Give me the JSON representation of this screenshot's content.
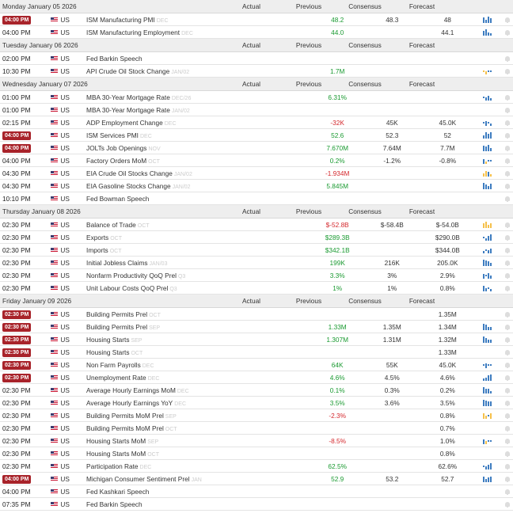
{
  "columns": {
    "actual": "Actual",
    "previous": "Previous",
    "consensus": "Consensus",
    "forecast": "Forecast"
  },
  "colors": {
    "badge": "#a8232a",
    "positive": "#1a9a31",
    "negative": "#d4282d",
    "chart_bar": "#3d7cc0",
    "chart_alt": "#f5c04a"
  },
  "days": [
    {
      "title": "Monday January 05 2026",
      "events": [
        {
          "time": "04:00 PM",
          "badge": true,
          "currency": "US",
          "name": "ISM Manufacturing PMI",
          "period": "DEC",
          "actual": "",
          "previous": "48.2",
          "prev_color": "green",
          "consensus": "48.3",
          "forecast": "48",
          "chart": "b5,b3,b6,b4"
        },
        {
          "time": "04:00 PM",
          "badge": false,
          "currency": "US",
          "name": "ISM Manufacturing Employment",
          "period": "DEC",
          "actual": "",
          "previous": "44.0",
          "prev_color": "green",
          "consensus": "",
          "forecast": "44.1",
          "chart": "b4,b6,b3,b2"
        }
      ]
    },
    {
      "title": "Tuesday January 06 2026",
      "events": [
        {
          "time": "02:00 PM",
          "badge": false,
          "currency": "US",
          "name": "Fed Barkin Speech",
          "period": "",
          "actual": "",
          "previous": "",
          "prev_color": "",
          "consensus": "",
          "forecast": "",
          "chart": ""
        },
        {
          "time": "10:30 PM",
          "badge": false,
          "currency": "US",
          "name": "API Crude Oil Stock Change",
          "period": "JAN/02",
          "actual": "",
          "previous": "1.7M",
          "prev_color": "green",
          "consensus": "",
          "forecast": "",
          "chart": "dy,y3,d,d"
        }
      ]
    },
    {
      "title": "Wednesday January 07 2026",
      "events": [
        {
          "time": "01:00 PM",
          "badge": false,
          "currency": "US",
          "name": "MBA 30-Year Mortgage Rate",
          "period": "DEC/26",
          "actual": "",
          "previous": "6.31%",
          "prev_color": "green",
          "consensus": "",
          "forecast": "",
          "chart": "d,b3,b4,b2"
        },
        {
          "time": "01:00 PM",
          "badge": false,
          "currency": "US",
          "name": "MBA 30-Year Mortgage Rate",
          "period": "JAN/02",
          "actual": "",
          "previous": "",
          "prev_color": "",
          "consensus": "",
          "forecast": "",
          "chart": ""
        },
        {
          "time": "02:15 PM",
          "badge": false,
          "currency": "US",
          "name": "ADP Employment Change",
          "period": "DEC",
          "actual": "",
          "previous": "-32K",
          "prev_color": "red",
          "consensus": "45K",
          "forecast": "45.0K",
          "chart": "d,b4,d,b2"
        },
        {
          "time": "04:00 PM",
          "badge": true,
          "currency": "US",
          "name": "ISM Services PMI",
          "period": "DEC",
          "actual": "",
          "previous": "52.6",
          "prev_color": "green",
          "consensus": "52.3",
          "forecast": "52",
          "chart": "b3,b6,b4,b6"
        },
        {
          "time": "04:00 PM",
          "badge": true,
          "currency": "US",
          "name": "JOLTs Job Openings",
          "period": "NOV",
          "actual": "",
          "previous": "7.670M",
          "prev_color": "green",
          "consensus": "7.64M",
          "forecast": "7.7M",
          "chart": "b5,b4,b6,b3"
        },
        {
          "time": "04:00 PM",
          "badge": false,
          "currency": "US",
          "name": "Factory Orders MoM",
          "period": "OCT",
          "actual": "",
          "previous": "0.2%",
          "prev_color": "green",
          "consensus": "-1.2%",
          "forecast": "-0.8%",
          "chart": "b4,y2,d,d"
        },
        {
          "time": "04:30 PM",
          "badge": false,
          "currency": "US",
          "name": "EIA Crude Oil Stocks Change",
          "period": "JAN/02",
          "actual": "",
          "previous": "-1.934M",
          "prev_color": "red",
          "consensus": "",
          "forecast": "",
          "chart": "y3,y5,b4,y2"
        },
        {
          "time": "04:30 PM",
          "badge": false,
          "currency": "US",
          "name": "EIA Gasoline Stocks Change",
          "period": "JAN/02",
          "actual": "",
          "previous": "5.845M",
          "prev_color": "green",
          "consensus": "",
          "forecast": "",
          "chart": "b6,b4,b3,b5"
        },
        {
          "time": "10:10 PM",
          "badge": false,
          "currency": "US",
          "name": "Fed Bowman Speech",
          "period": "",
          "actual": "",
          "previous": "",
          "prev_color": "",
          "consensus": "",
          "forecast": "",
          "chart": ""
        }
      ]
    },
    {
      "title": "Thursday January 08 2026",
      "events": [
        {
          "time": "02:30 PM",
          "badge": false,
          "currency": "US",
          "name": "Balance of Trade",
          "period": "OCT",
          "actual": "",
          "previous": "$-52.8B",
          "prev_color": "red",
          "consensus": "$-58.4B",
          "forecast": "$-54.0B",
          "chart": "y4,y6,y3,y4"
        },
        {
          "time": "02:30 PM",
          "badge": false,
          "currency": "US",
          "name": "Exports",
          "period": "OCT",
          "actual": "",
          "previous": "$289.3B",
          "prev_color": "green",
          "consensus": "",
          "forecast": "$290.0B",
          "chart": "d,b2,b4,b6"
        },
        {
          "time": "02:30 PM",
          "badge": false,
          "currency": "US",
          "name": "Imports",
          "period": "OCT",
          "actual": "",
          "previous": "$342.1B",
          "prev_color": "green",
          "consensus": "",
          "forecast": "$344.0B",
          "chart": "b2,d,b3,b4"
        },
        {
          "time": "02:30 PM",
          "badge": false,
          "currency": "US",
          "name": "Initial Jobless Claims",
          "period": "JAN/03",
          "actual": "",
          "previous": "199K",
          "prev_color": "green",
          "consensus": "216K",
          "forecast": "205.0K",
          "chart": "b6,b5,b4,b3"
        },
        {
          "time": "02:30 PM",
          "badge": false,
          "currency": "US",
          "name": "Nonfarm Productivity QoQ Prel",
          "period": "Q3",
          "actual": "",
          "previous": "3.3%",
          "prev_color": "green",
          "consensus": "3%",
          "forecast": "2.9%",
          "chart": "b4,d,b5,b3"
        },
        {
          "time": "02:30 PM",
          "badge": false,
          "currency": "US",
          "name": "Unit Labour Costs QoQ Prel",
          "period": "Q3",
          "actual": "",
          "previous": "1%",
          "prev_color": "green",
          "consensus": "1%",
          "forecast": "0.8%",
          "chart": "b5,b3,d,b2"
        }
      ]
    },
    {
      "title": "Friday January 09 2026",
      "events": [
        {
          "time": "02:30 PM",
          "badge": true,
          "currency": "US",
          "name": "Building Permits Prel",
          "period": "OCT",
          "actual": "",
          "previous": "",
          "prev_color": "",
          "consensus": "",
          "forecast": "1.35M",
          "chart": ""
        },
        {
          "time": "02:30 PM",
          "badge": true,
          "currency": "US",
          "name": "Building Permits Prel",
          "period": "SEP",
          "actual": "",
          "previous": "1.33M",
          "prev_color": "green",
          "consensus": "1.35M",
          "forecast": "1.34M",
          "chart": "b6,b5,b3,b3"
        },
        {
          "time": "02:30 PM",
          "badge": true,
          "currency": "US",
          "name": "Housing Starts",
          "period": "SEP",
          "actual": "",
          "previous": "1.307M",
          "prev_color": "green",
          "consensus": "1.31M",
          "forecast": "1.32M",
          "chart": "b6,b4,b3,b3"
        },
        {
          "time": "02:30 PM",
          "badge": true,
          "currency": "US",
          "name": "Housing Starts",
          "period": "OCT",
          "actual": "",
          "previous": "",
          "prev_color": "",
          "consensus": "",
          "forecast": "1.33M",
          "chart": ""
        },
        {
          "time": "02:30 PM",
          "badge": true,
          "currency": "US",
          "name": "Non Farm Payrolls",
          "period": "DEC",
          "actual": "",
          "previous": "64K",
          "prev_color": "green",
          "consensus": "55K",
          "forecast": "45.0K",
          "chart": "d,b4,d,d"
        },
        {
          "time": "02:30 PM",
          "badge": true,
          "currency": "US",
          "name": "Unemployment Rate",
          "period": "DEC",
          "actual": "",
          "previous": "4.6%",
          "prev_color": "green",
          "consensus": "4.5%",
          "forecast": "4.6%",
          "chart": "b2,b3,b5,b6"
        },
        {
          "time": "02:30 PM",
          "badge": false,
          "currency": "US",
          "name": "Average Hourly Earnings MoM",
          "period": "DEC",
          "actual": "",
          "previous": "0.1%",
          "prev_color": "green",
          "consensus": "0.3%",
          "forecast": "0.2%",
          "chart": "b6,b4,b4,b2"
        },
        {
          "time": "02:30 PM",
          "badge": false,
          "currency": "US",
          "name": "Average Hourly Earnings YoY",
          "period": "DEC",
          "actual": "",
          "previous": "3.5%",
          "prev_color": "green",
          "consensus": "3.6%",
          "forecast": "3.5%",
          "chart": "b6,b5,b4,b4"
        },
        {
          "time": "02:30 PM",
          "badge": false,
          "currency": "US",
          "name": "Building Permits MoM Prel",
          "period": "SEP",
          "actual": "",
          "previous": "-2.3%",
          "prev_color": "red",
          "consensus": "",
          "forecast": "0.8%",
          "chart": "y5,y3,d,y5"
        },
        {
          "time": "02:30 PM",
          "badge": false,
          "currency": "US",
          "name": "Building Permits MoM Prel",
          "period": "OCT",
          "actual": "",
          "previous": "",
          "prev_color": "",
          "consensus": "",
          "forecast": "0.7%",
          "chart": ""
        },
        {
          "time": "02:30 PM",
          "badge": false,
          "currency": "US",
          "name": "Housing Starts MoM",
          "period": "SEP",
          "actual": "",
          "previous": "-8.5%",
          "prev_color": "red",
          "consensus": "",
          "forecast": "1.0%",
          "chart": "b4,y3,d,d"
        },
        {
          "time": "02:30 PM",
          "badge": false,
          "currency": "US",
          "name": "Housing Starts MoM",
          "period": "OCT",
          "actual": "",
          "previous": "",
          "prev_color": "",
          "consensus": "",
          "forecast": "0.8%",
          "chart": ""
        },
        {
          "time": "02:30 PM",
          "badge": false,
          "currency": "US",
          "name": "Participation Rate",
          "period": "DEC",
          "actual": "",
          "previous": "62.5%",
          "prev_color": "green",
          "consensus": "",
          "forecast": "62.6%",
          "chart": "d,b3,b4,b6"
        },
        {
          "time": "04:00 PM",
          "badge": true,
          "currency": "US",
          "name": "Michigan Consumer Sentiment Prel",
          "period": "JAN",
          "actual": "",
          "previous": "52.9",
          "prev_color": "green",
          "consensus": "53.2",
          "forecast": "52.7",
          "chart": "b5,b3,b4,b5"
        },
        {
          "time": "04:00 PM",
          "badge": false,
          "currency": "US",
          "name": "Fed Kashkari Speech",
          "period": "",
          "actual": "",
          "previous": "",
          "prev_color": "",
          "consensus": "",
          "forecast": "",
          "chart": ""
        },
        {
          "time": "07:35 PM",
          "badge": false,
          "currency": "US",
          "name": "Fed Barkin Speech",
          "period": "",
          "actual": "",
          "previous": "",
          "prev_color": "",
          "consensus": "",
          "forecast": "",
          "chart": ""
        }
      ]
    }
  ]
}
